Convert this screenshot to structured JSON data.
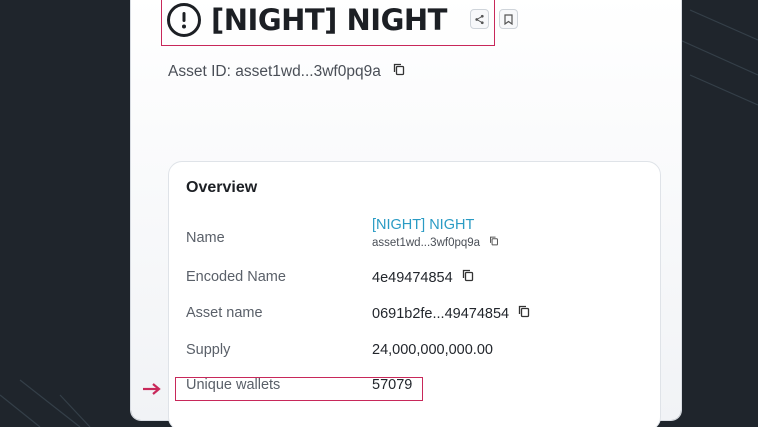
{
  "header": {
    "title": "[NIGHT] NIGHT",
    "asset_id_label": "Asset ID:",
    "asset_id_value": "asset1wd...3wf0pq9a"
  },
  "overview": {
    "title": "Overview",
    "rows": [
      {
        "label": "Name",
        "value": "[NIGHT] NIGHT",
        "sub": "asset1wd...3wf0pq9a"
      },
      {
        "label": "Encoded Name",
        "value": "4e49474854"
      },
      {
        "label": "Asset name",
        "value": "0691b2fe...49474854"
      },
      {
        "label": "Supply",
        "value": "24,000,000,000.00"
      },
      {
        "label": "Unique wallets",
        "value": "57079"
      }
    ]
  },
  "colors": {
    "highlight": "#c8285a",
    "link": "#2a9bc4",
    "background": "#1f252c"
  }
}
